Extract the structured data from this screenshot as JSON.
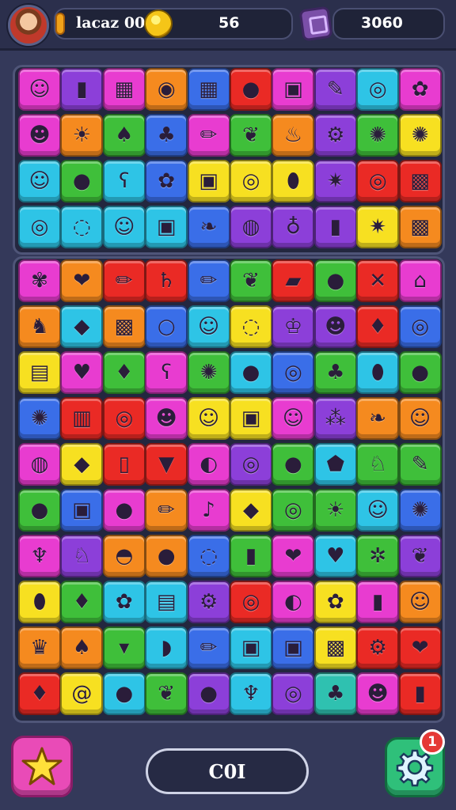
{
  "hud": {
    "player_name": "lacaz 00rI",
    "coins": "56",
    "gems": "3060"
  },
  "footer": {
    "moves_label": "C0I",
    "notification_count": "1"
  },
  "colors": {
    "R": "#ea2a25",
    "O": "#f58a1f",
    "Y": "#f7e021",
    "G": "#3fbf3a",
    "C": "#2ec4e6",
    "B": "#3a6ee8",
    "P": "#8c3fd9",
    "M": "#e83cd0",
    "T": "#2fc1b0"
  },
  "board_top": [
    {
      "colors": "MPMOBRMPCM",
      "icons": [
        "smiley-icon",
        "bottle-icon",
        "grid-icon",
        "disc-icon",
        "grid-icon",
        "drop-icon",
        "box-icon",
        "brush-icon",
        "ring-icon",
        "flower-icon"
      ]
    },
    {
      "colors": "MOGBMGOPGY",
      "icons": [
        "face-icon",
        "sun-icon",
        "mushroom-icon",
        "owl-icon",
        "pencil-icon",
        "leaf-icon",
        "flame-icon",
        "gear-icon",
        "splat-icon",
        "splat-icon"
      ]
    },
    {
      "colors": "CGCBYYYPRR",
      "icons": [
        "smiley-icon",
        "ball-icon",
        "bear-icon",
        "flower-icon",
        "box-icon",
        "ring-icon",
        "balloon-icon",
        "star-icon",
        "target-icon",
        "robot-icon"
      ]
    },
    {
      "colors": "CCCCBPPPYO",
      "icons": [
        "ring-icon",
        "swirl-icon",
        "smiley-icon",
        "box-icon",
        "fish-icon",
        "donut-icon",
        "lamp-icon",
        "bottle-icon",
        "star-icon",
        "robot-icon"
      ]
    }
  ],
  "board_bottom": [
    {
      "colors": "MORRBGRGRM",
      "icons": [
        "cotton-candy-icon",
        "apple-icon",
        "pencil-icon",
        "saturn-icon",
        "pencil-icon",
        "leaf-icon",
        "bandage-icon",
        "drop-icon",
        "cross-icon",
        "house-icon"
      ]
    },
    {
      "colors": "OCOBCYPPRB",
      "icons": [
        "cat-icon",
        "gem-icon",
        "robot-icon",
        "bubble-icon",
        "smiley-icon",
        "swirl-icon",
        "crown-icon",
        "face-icon",
        "pepper-icon",
        "ring-icon"
      ]
    },
    {
      "colors": "YMGMGCBGCG",
      "icons": [
        "radio-icon",
        "heart-icon",
        "strawberry-icon",
        "bear-icon",
        "splat-icon",
        "ball-icon",
        "ring-icon",
        "pear-icon",
        "balloon-icon",
        "ball-icon"
      ]
    },
    {
      "colors": "BRRMYYMPOO",
      "icons": [
        "splat-icon",
        "cake-icon",
        "target-icon",
        "face-icon",
        "smiley-icon",
        "box-icon",
        "smiley-icon",
        "grapes-icon",
        "fish-icon",
        "smiley-icon"
      ]
    },
    {
      "colors": "MYRRMPGCGG",
      "icons": [
        "donut-icon",
        "gem-icon",
        "popsicle-icon",
        "cone-icon",
        "lollipop-icon",
        "ring-icon",
        "ball-icon",
        "shield-icon",
        "squirrel-icon",
        "brush-icon"
      ]
    },
    {
      "colors": "GBMOMYGGCB",
      "icons": [
        "ball-icon",
        "box-icon",
        "drop-icon",
        "pencil-icon",
        "note-icon",
        "gem-icon",
        "ring-icon",
        "sun-icon",
        "smiley-icon",
        "splat-icon"
      ]
    },
    {
      "colors": "MPOOBGMCGP",
      "icons": [
        "cupcake-icon",
        "bird-icon",
        "dome-icon",
        "drop-icon",
        "swirl-icon",
        "bottle-icon",
        "apple-icon",
        "sock-icon",
        "bug-icon",
        "leaf-icon"
      ]
    },
    {
      "colors": "YGCCPRMYMO",
      "icons": [
        "balloon-icon",
        "pepper-icon",
        "flower-icon",
        "radio-icon",
        "gear-icon",
        "target-icon",
        "lollipop-icon",
        "flower-icon",
        "bottle-icon",
        "smiley-icon"
      ]
    },
    {
      "colors": "OOGCBCBYRR",
      "icons": [
        "frog-icon",
        "chili-icon",
        "carrot-icon",
        "lemon-icon",
        "pencil-icon",
        "box-icon",
        "box-icon",
        "robot-icon",
        "gear-icon",
        "apple-icon"
      ]
    },
    {
      "colors": "RYCGPCPTMR",
      "icons": [
        "pepper-icon",
        "snail-icon",
        "drop-icon",
        "leaf-icon",
        "ball-icon",
        "cactus-icon",
        "ring-icon",
        "pear-icon",
        "face-icon",
        "bottle-icon"
      ]
    }
  ]
}
